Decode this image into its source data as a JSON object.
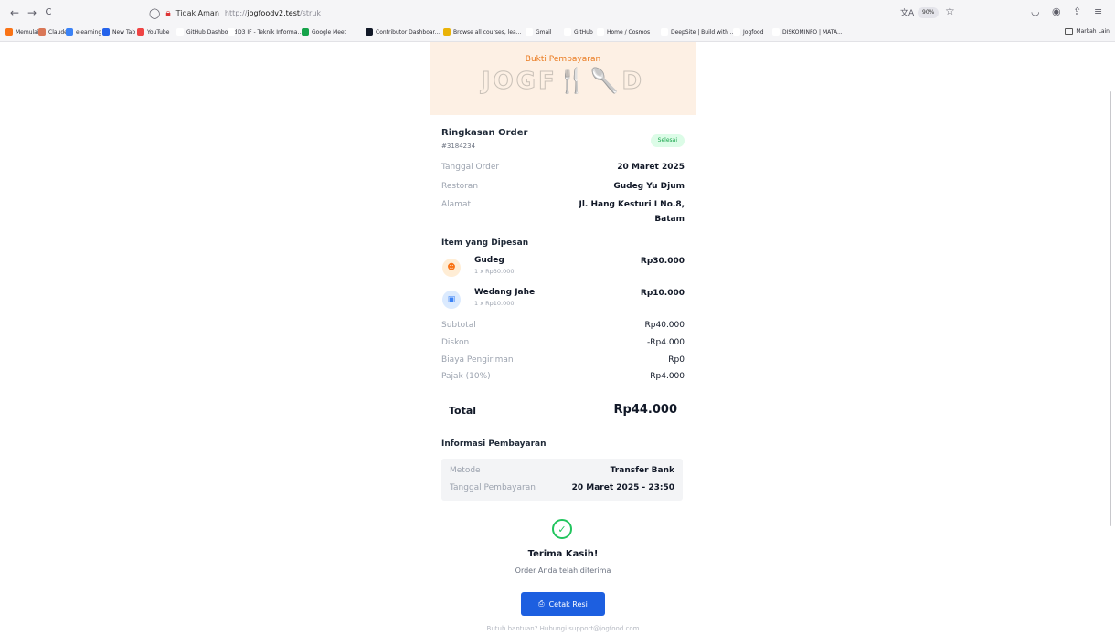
{
  "browser": {
    "nav": {
      "back": "←",
      "forward": "→",
      "reload": "C"
    },
    "address": {
      "security_label": "Tidak Aman",
      "url_scheme": "http://",
      "url_host": "jogfoodv2.test",
      "url_path": "/struk"
    },
    "zoom": "90%",
    "bookmarks": [
      {
        "label": "Memulai",
        "color": "#f97316"
      },
      {
        "label": "Claude",
        "color": "#d97757"
      },
      {
        "label": "elearning if",
        "color": "#3b82f6"
      },
      {
        "label": "New Tab",
        "color": "#2563eb"
      },
      {
        "label": "YouTube",
        "color": "#ef4444"
      },
      {
        "label": "GitHub Dashboard",
        "color": "#ffffff"
      },
      {
        "label": "D3 IF - Teknik Informa...",
        "color": "#ffffff"
      },
      {
        "label": "Google Meet",
        "color": "#16a34a"
      },
      {
        "label": "Contributor Dashboar...",
        "color": "#111827"
      },
      {
        "label": "Browse all courses, lea...",
        "color": "#eab308"
      },
      {
        "label": "Gmail",
        "color": "#ffffff"
      },
      {
        "label": "GitHub",
        "color": "#ffffff"
      },
      {
        "label": "Home / Cosmos",
        "color": "#ffffff"
      },
      {
        "label": "DeepSite | Build with ...",
        "color": "#ffffff"
      },
      {
        "label": "Jogfood",
        "color": "#ffffff"
      },
      {
        "label": "DISKOMINFO | MATA...",
        "color": "#ffffff"
      }
    ],
    "bookmarks_other": "Markah Lain"
  },
  "receipt": {
    "hero_subtitle": "Bukti Pembayaran",
    "logo": "JOGF🍴🥄D",
    "order": {
      "title": "Ringkasan Order",
      "id": "#3184234",
      "status": "Selesai"
    },
    "details": [
      {
        "label": "Tanggal Order",
        "value": "20 Maret 2025"
      },
      {
        "label": "Restoran",
        "value": "Gudeg Yu Djum"
      },
      {
        "label": "Alamat",
        "value_line1": "Jl. Hang Kesturi I No.8,",
        "value_line2": "Batam"
      }
    ],
    "items_title": "Item yang Dipesan",
    "items": [
      {
        "name": "Gudeg",
        "qty": "1 x Rp30.000",
        "price": "Rp30.000",
        "icon": "food-icon",
        "icon_bg": "#ffedd5",
        "icon_color": "#f97316"
      },
      {
        "name": "Wedang Jahe",
        "qty": "1 x Rp10.000",
        "price": "Rp10.000",
        "icon": "drink-icon",
        "icon_bg": "#dbeafe",
        "icon_color": "#3b82f6"
      }
    ],
    "summary": [
      {
        "label": "Subtotal",
        "value": "Rp40.000"
      },
      {
        "label": "Diskon",
        "value": "-Rp4.000"
      },
      {
        "label": "Biaya Pengiriman",
        "value": "Rp0"
      },
      {
        "label": "Pajak (10%)",
        "value": "Rp4.000"
      }
    ],
    "total": {
      "label": "Total",
      "value": "Rp44.000"
    },
    "payment": {
      "title": "Informasi Pembayaran",
      "rows": [
        {
          "label": "Metode",
          "value": "Transfer Bank"
        },
        {
          "label": "Tanggal Pembayaran",
          "value": "20 Maret 2025 - 23:50"
        }
      ]
    },
    "thanks_title": "Terima Kasih!",
    "thanks_sub": "Order Anda telah diterima",
    "print_label": "Cetak Resi",
    "help": "Butuh bantuan? Hubungi support@jogfood.com"
  },
  "colors": {
    "accent": "#1d5fe0",
    "brand_orange": "#ea7a1f",
    "success": "#16a34a"
  }
}
